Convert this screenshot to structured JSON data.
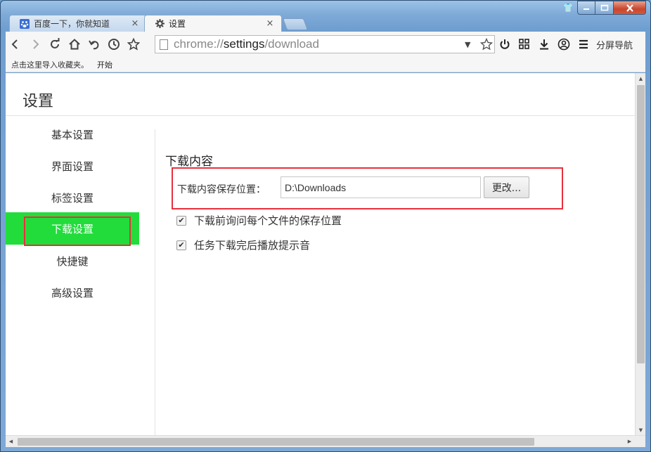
{
  "window": {
    "controls": {
      "skin_icon": "shirt-icon",
      "minimize": "minimize-icon",
      "maximize": "maximize-icon",
      "close": "close-icon"
    }
  },
  "tabs": [
    {
      "label": "百度一下，你就知道",
      "icon": "baidu-paw-icon",
      "active": false
    },
    {
      "label": "设置",
      "icon": "gear-icon",
      "active": true
    }
  ],
  "toolbar": {
    "url_prefix": "chrome://",
    "url_host": "settings",
    "url_path": "/download",
    "split_nav_label": "分屏导航",
    "icons": [
      "back-icon",
      "forward-icon",
      "reload-icon",
      "home-icon",
      "undo-icon",
      "history-icon",
      "star-icon",
      "power-icon",
      "apps-icon",
      "download-icon",
      "user-icon",
      "menu-icon"
    ]
  },
  "bookmarks": {
    "import_text": "点击这里导入收藏夹。",
    "start_link": "开始"
  },
  "page": {
    "title": "设置"
  },
  "sidebar": {
    "items": [
      {
        "label": "基本设置",
        "active": false
      },
      {
        "label": "界面设置",
        "active": false
      },
      {
        "label": "标签设置",
        "active": false
      },
      {
        "label": "下载设置",
        "active": true
      },
      {
        "label": "快捷键",
        "active": false
      },
      {
        "label": "高级设置",
        "active": false
      }
    ]
  },
  "download": {
    "section_title": "下载内容",
    "location_label": "下载内容保存位置：",
    "location_value": "D:\\Downloads",
    "change_button": "更改...",
    "options": [
      {
        "label": "下载前询问每个文件的保存位置",
        "checked": true
      },
      {
        "label": "任务下载完后播放提示音",
        "checked": true
      }
    ]
  },
  "colors": {
    "active_sidebar": "#22dc3c",
    "highlight_box": "#e8303c"
  }
}
